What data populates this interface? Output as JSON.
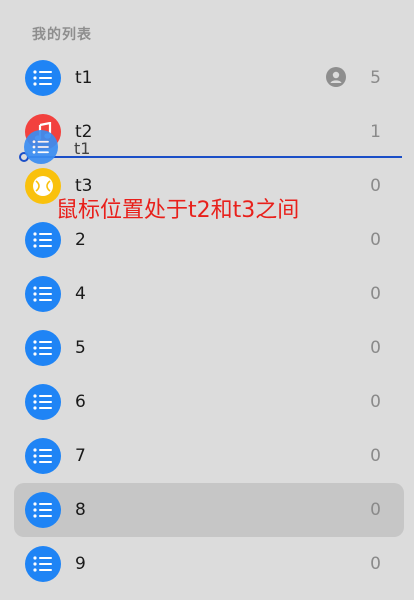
{
  "section_title": "我的列表",
  "lists": [
    {
      "name": "t1",
      "count": "5",
      "icon": "list-icon",
      "color": "#1f84f5",
      "shared": true
    },
    {
      "name": "t2",
      "count": "1",
      "icon": "music-note-icon",
      "color": "#f2413e"
    },
    {
      "name": "t3",
      "count": "0",
      "icon": "baseball-icon",
      "color": "#f9c10d"
    },
    {
      "name": "2",
      "count": "0",
      "icon": "list-icon",
      "color": "#1f84f5"
    },
    {
      "name": "4",
      "count": "0",
      "icon": "list-icon",
      "color": "#1f84f5"
    },
    {
      "name": "5",
      "count": "0",
      "icon": "list-icon",
      "color": "#1f84f5"
    },
    {
      "name": "6",
      "count": "0",
      "icon": "list-icon",
      "color": "#1f84f5"
    },
    {
      "name": "7",
      "count": "0",
      "icon": "list-icon",
      "color": "#1f84f5"
    },
    {
      "name": "8",
      "count": "0",
      "icon": "list-icon",
      "color": "#1f84f5",
      "selected": true
    },
    {
      "name": "9",
      "count": "0",
      "icon": "list-icon",
      "color": "#1f84f5"
    }
  ],
  "drag": {
    "ghost_name": "t1"
  },
  "annotation": "鼠标位置处于t2和t3之间"
}
